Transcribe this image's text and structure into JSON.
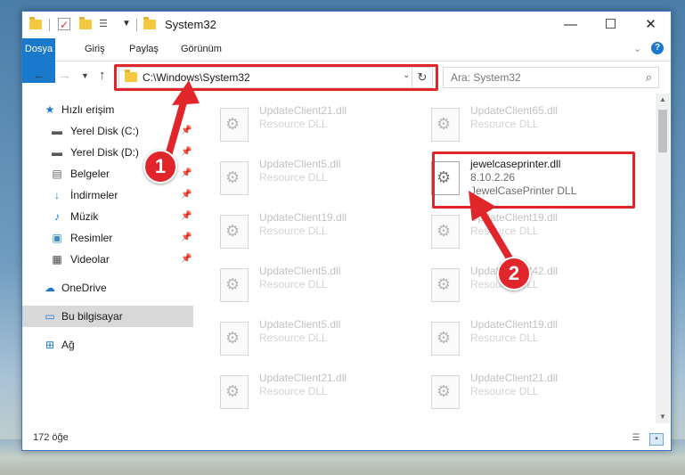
{
  "window": {
    "title": "System32",
    "controls": {
      "minimize": "—",
      "maximize": "☐",
      "close": "✕"
    }
  },
  "ribbon": {
    "tabs": [
      "Dosya",
      "Giriş",
      "Paylaş",
      "Görünüm"
    ]
  },
  "address_bar": {
    "path": "C:\\Windows\\System32"
  },
  "search": {
    "placeholder": "Ara: System32"
  },
  "sidebar": {
    "items": [
      {
        "label": "Hızlı erişim",
        "icon": "star-icon"
      },
      {
        "label": "Yerel Disk (C:)",
        "icon": "drive-icon"
      },
      {
        "label": "Yerel Disk (D:)",
        "icon": "drive-icon"
      },
      {
        "label": "Belgeler",
        "icon": "documents-icon"
      },
      {
        "label": "İndirmeler",
        "icon": "download-icon"
      },
      {
        "label": "Müzik",
        "icon": "music-icon"
      },
      {
        "label": "Resimler",
        "icon": "pictures-icon"
      },
      {
        "label": "Videolar",
        "icon": "videos-icon"
      },
      {
        "label": "OneDrive",
        "icon": "cloud-icon"
      },
      {
        "label": "Bu bilgisayar",
        "icon": "computer-icon"
      },
      {
        "label": "Ağ",
        "icon": "network-icon"
      }
    ]
  },
  "files": [
    {
      "name": "UpdateClient21.dll",
      "type": "Resource DLL"
    },
    {
      "name": "UpdateClient65.dll",
      "type": "Resource DLL"
    },
    {
      "name": "UpdateClient5.dll",
      "type": "Resource DLL"
    },
    {
      "name": "jewelcaseprinter.dll",
      "version": "8.10.2.26",
      "type": "JewelCasePrinter DLL",
      "selected": true
    },
    {
      "name": "UpdateClient19.dll",
      "type": "Resource DLL"
    },
    {
      "name": "UpdateClient19.dll",
      "type": "Resource DLL"
    },
    {
      "name": "UpdateClient5.dll",
      "type": "Resource DLL"
    },
    {
      "name": "UpdateClient42.dll",
      "type": "Resource DLL"
    },
    {
      "name": "UpdateClient5.dll",
      "type": "Resource DLL"
    },
    {
      "name": "UpdateClient19.dll",
      "type": "Resource DLL"
    },
    {
      "name": "UpdateClient21.dll",
      "type": "Resource DLL"
    },
    {
      "name": "UpdateClient21.dll",
      "type": "Resource DLL"
    }
  ],
  "status": {
    "item_count": "172 öğe"
  },
  "annotations": {
    "step1": "1",
    "step2": "2",
    "color": "#e0262b"
  },
  "colors": {
    "accent": "#1979ca",
    "highlight": "#e0262b"
  }
}
